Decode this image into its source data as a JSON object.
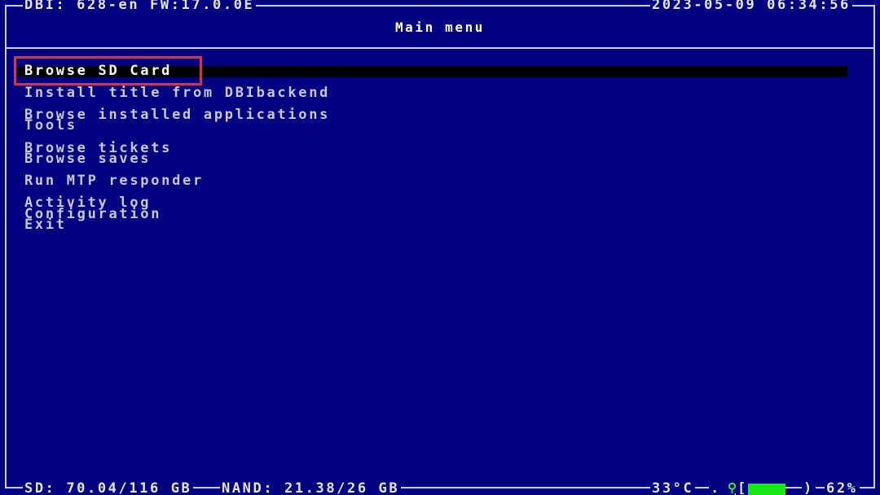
{
  "header": {
    "app_info": "DBI: 628-en FW:17.0.0E",
    "datetime": "2023-05-09 06:34:56",
    "title": "Main menu"
  },
  "menu": {
    "items": [
      {
        "label": "Browse SD Card",
        "selected": true
      },
      {
        "label": "Install title from DBIbackend"
      },
      {
        "label": "Browse installed applications"
      },
      {
        "label": "Tools"
      },
      {
        "label": "Browse tickets"
      },
      {
        "label": "Browse saves"
      },
      {
        "label": "Run MTP responder"
      },
      {
        "label": "Activity log"
      },
      {
        "label": "Configuration"
      },
      {
        "label": "Exit"
      }
    ]
  },
  "footer": {
    "sd": "SD: 70.04/116 GB",
    "nand": "NAND: 21.38/26 GB",
    "temperature": "33°C",
    "battery_percent": "62%",
    "battery_level": 0.62,
    "charging_icon": "plug-icon"
  },
  "colors": {
    "background": "#000080",
    "text": "#c8c8d8",
    "selected_text": "#ffffff",
    "selection_bar": "#000000",
    "highlight_box": "#e03040",
    "battery_fill": "#18e818"
  }
}
